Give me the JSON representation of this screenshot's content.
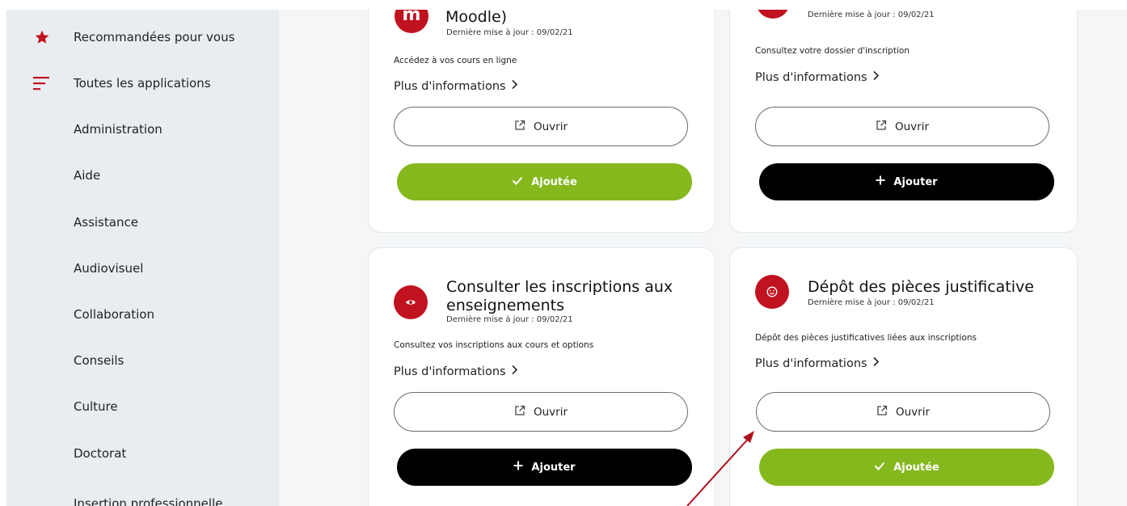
{
  "sidebar": {
    "items": [
      {
        "label": "Recommandées pour vous",
        "icon": "star-icon"
      },
      {
        "label": "Toutes les applications",
        "icon": "list-icon"
      },
      {
        "label": "Administration"
      },
      {
        "label": "Aide"
      },
      {
        "label": "Assistance"
      },
      {
        "label": "Audiovisuel"
      },
      {
        "label": "Collaboration"
      },
      {
        "label": "Conseils"
      },
      {
        "label": "Culture"
      },
      {
        "label": "Doctorat"
      },
      {
        "label": "Insertion professionnelle"
      }
    ]
  },
  "cards": [
    {
      "icon": "moodle-icon",
      "icon_glyph": "m",
      "title_line1": "Moodle)",
      "title_line2": "",
      "date": "Dernière mise à jour : 09/02/21",
      "description": "Accédez à vos cours en ligne",
      "more": "Plus d'informations",
      "open": "Ouvrir",
      "action": "Ajoutée",
      "action_state": "added"
    },
    {
      "icon": "app-icon",
      "title_line1": "",
      "title_line2": "",
      "date": "Dernière mise à jour : 09/02/21",
      "description": "Consultez votre dossier d'inscription",
      "more": "Plus d'informations",
      "open": "Ouvrir",
      "action": "Ajouter",
      "action_state": "add"
    },
    {
      "icon": "eye-icon",
      "title_line1": "Consulter les inscriptions aux",
      "title_line2": "enseignements",
      "date": "Dernière mise à jour : 09/02/21",
      "description": "Consultez vos inscriptions aux cours et options",
      "more": "Plus d'informations",
      "open": "Ouvrir",
      "action": "Ajouter",
      "action_state": "add"
    },
    {
      "icon": "smiley-icon",
      "title_line1": "Dépôt des pièces justificative",
      "title_line2": "",
      "date": "Dernière mise à jour : 09/02/21",
      "description": "Dépôt des pièces justificatives liées aux inscriptions",
      "more": "Plus d'informations",
      "open": "Ouvrir",
      "action": "Ajoutée",
      "action_state": "added"
    }
  ],
  "colors": {
    "brand_red": "#c1121f",
    "added_green": "#84b81d",
    "add_black": "#000000",
    "sidebar_bg": "#e9edf1",
    "annotation_arrow": "#b0101c"
  }
}
